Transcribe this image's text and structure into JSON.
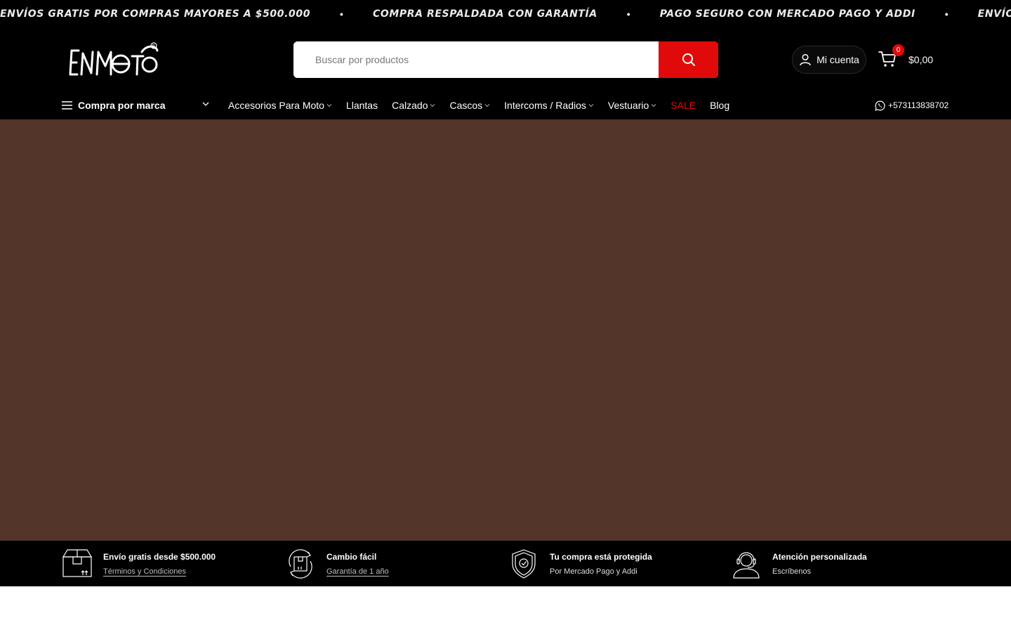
{
  "marquee": {
    "items": [
      "ENVÍOS GRATIS POR COMPRAS MAYORES A $500.000",
      "COMPRA RESPALDADA CON GARANTÍA",
      "PAGO SEGURO CON MERCADO PAGO Y ADDI",
      "ENVÍOS SEGUR"
    ],
    "separator": "•"
  },
  "header": {
    "logo_text": "ENMOTO",
    "search": {
      "placeholder": "Buscar por productos",
      "value": ""
    },
    "account_label": "Mi cuenta",
    "cart": {
      "count": "0",
      "total": "$0,00"
    }
  },
  "nav": {
    "brand_menu_label": "Compra por marca",
    "links": [
      {
        "label": "Accesorios Para Moto",
        "has_dropdown": true
      },
      {
        "label": "Llantas",
        "has_dropdown": false
      },
      {
        "label": "Calzado",
        "has_dropdown": true
      },
      {
        "label": "Cascos",
        "has_dropdown": true
      },
      {
        "label": "Intercoms / Radios",
        "has_dropdown": true
      },
      {
        "label": "Vestuario",
        "has_dropdown": true
      },
      {
        "label": "SALE",
        "has_dropdown": false
      },
      {
        "label": "Blog",
        "has_dropdown": false
      }
    ],
    "whatsapp": "+573113838702"
  },
  "hero": {
    "background": "#523428"
  },
  "features": [
    {
      "title": "Envío gratis desde $500.000",
      "sub": "Términos y Condiciones",
      "sub_is_link": true,
      "icon": "box-icon"
    },
    {
      "title": "Cambio fácil",
      "sub": "Garantía de 1 año",
      "sub_is_link": true,
      "icon": "exchange-box-icon"
    },
    {
      "title": "Tu compra está protegida",
      "sub": "Por Mercado Pago y Addi",
      "sub_is_link": false,
      "icon": "shield-icon"
    },
    {
      "title": "Atención personalizada",
      "sub": "Escríbenos",
      "sub_is_link": false,
      "icon": "support-agent-icon"
    }
  ],
  "colors": {
    "accent_red": "#e10a0a",
    "header_bg": "#000000",
    "hero_bg": "#523428"
  }
}
